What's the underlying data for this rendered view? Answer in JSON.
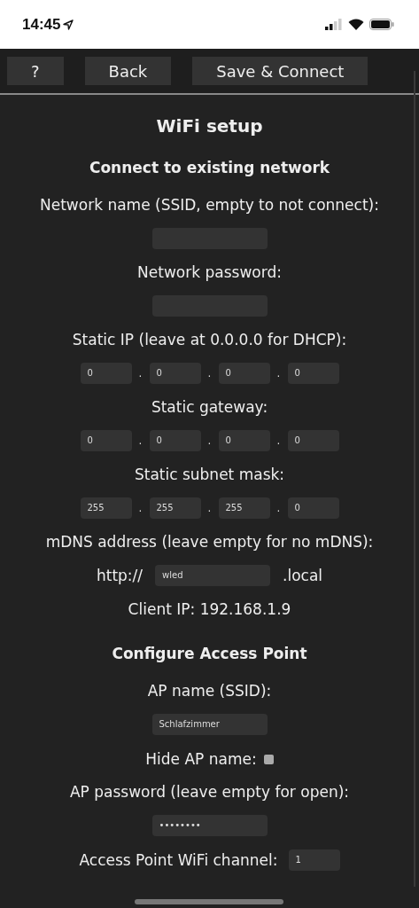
{
  "status_bar": {
    "time": "14:45"
  },
  "toolbar": {
    "buttons": [
      "?",
      "Back",
      "Save & Connect"
    ]
  },
  "title": "WiFi setup",
  "sections": [
    {
      "heading": "Connect to existing network",
      "items": [
        {
          "kind": "label",
          "text": "Network name (SSID, empty to not connect):"
        },
        {
          "kind": "field"
        },
        {
          "kind": "label",
          "text": "Network password:"
        },
        {
          "kind": "field"
        },
        {
          "kind": "label",
          "text": "Static IP (leave at 0.0.0.0 for DHCP):"
        },
        {
          "kind": "ip",
          "octets": [
            "0",
            "0",
            "0",
            "0"
          ],
          "separators": [
            ".",
            ".",
            "."
          ]
        },
        {
          "kind": "label",
          "text": "Static gateway:"
        },
        {
          "kind": "ip",
          "octets": [
            "0",
            "0",
            "0",
            "0"
          ],
          "separators": [
            ".",
            ".",
            "."
          ]
        },
        {
          "kind": "label",
          "text": "Static subnet mask:"
        },
        {
          "kind": "ip",
          "octets": [
            "255",
            "255",
            "255",
            "0"
          ],
          "separators": [
            ".",
            ".",
            "."
          ]
        },
        {
          "kind": "label",
          "text": "mDNS address (leave empty for no mDNS):"
        },
        {
          "kind": "mdns",
          "prefix": "http://",
          "value": "wled",
          "suffix": ".local"
        },
        {
          "kind": "label",
          "text": "Client IP: 192.168.1.9"
        }
      ]
    },
    {
      "heading": "Configure Access Point",
      "items": [
        {
          "kind": "label",
          "text": "AP name (SSID):"
        },
        {
          "kind": "field",
          "value": "Schlafzimmer"
        },
        {
          "kind": "checkbox",
          "text": "Hide AP name:",
          "checked": false
        },
        {
          "kind": "label",
          "text": "AP password (leave empty for open):"
        },
        {
          "kind": "field",
          "value": "••••••••"
        },
        {
          "kind": "inline_field",
          "text": "Access Point WiFi channel:",
          "value": "1"
        }
      ]
    }
  ]
}
